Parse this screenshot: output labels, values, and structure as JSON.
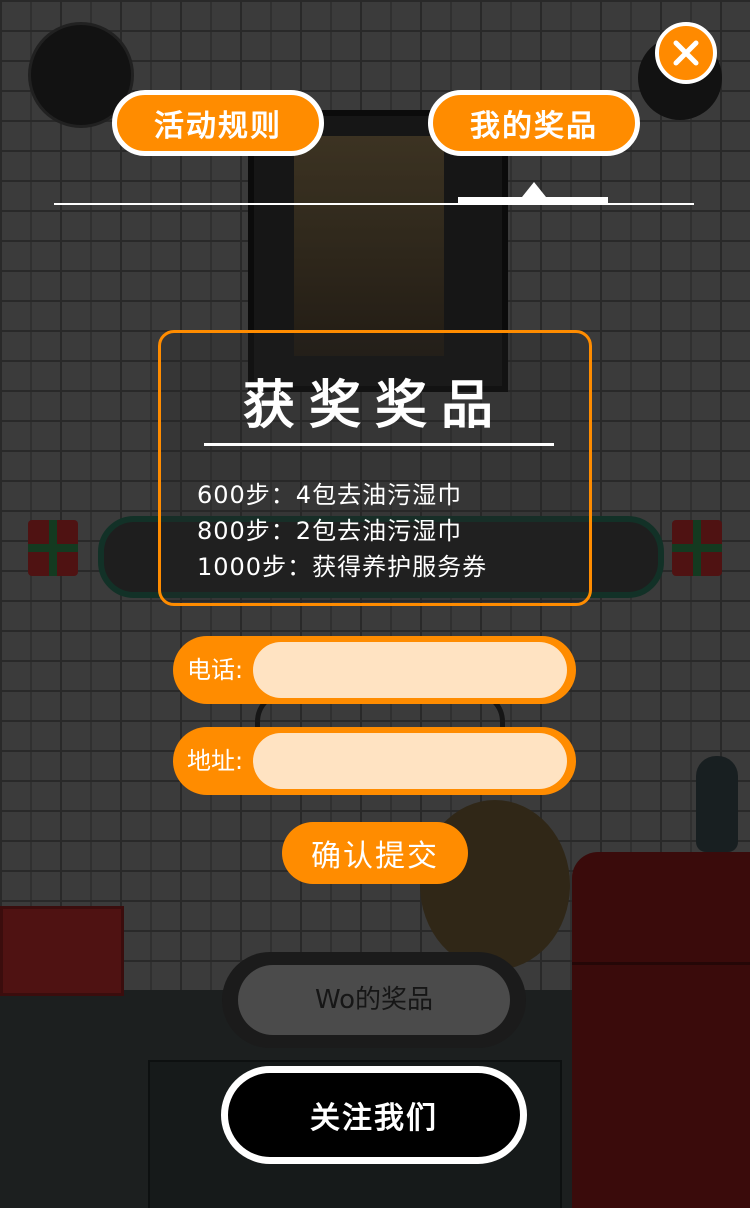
{
  "tabs": {
    "rules_label": "活动规则",
    "prizes_label": "我的奖品",
    "active": "prizes"
  },
  "close_icon": "close-icon",
  "prize_panel": {
    "title": "获奖奖品",
    "items": [
      "600步：4包去油污湿巾",
      "800步：2包去油污湿巾",
      "1000步：获得养护服务券"
    ]
  },
  "form": {
    "phone_label": "电话:",
    "phone_value": "",
    "address_label": "地址:",
    "address_value": "",
    "submit_label": "确认提交"
  },
  "buttons": {
    "my_prizes_label": "Wo的奖品",
    "follow_label": "关注我们"
  },
  "colors": {
    "accent": "#ff8c00",
    "input_bg": "#ffe3c2",
    "white": "#ffffff",
    "black": "#000000"
  }
}
